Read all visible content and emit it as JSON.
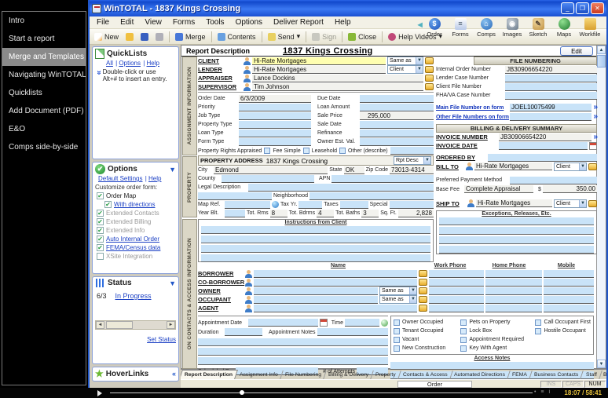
{
  "video": {
    "chapters": [
      "Intro",
      "Start a report",
      "Merge and Templates",
      "Navigating WinTOTAL",
      "Quicklists",
      "Add Document (PDF)",
      "E&O",
      "Comps side-by-side"
    ],
    "time": "18:07 / 58:41"
  },
  "window": {
    "title": "WinTOTAL - 1837 Kings Crossing",
    "menus": [
      "File",
      "Edit",
      "View",
      "Forms",
      "Tools",
      "Options",
      "Deliver Report",
      "Help"
    ],
    "toolbar": {
      "new": "New",
      "merge": "Merge",
      "contents": "Contents",
      "send": "Send",
      "sign": "Sign",
      "close": "Close",
      "help_videos": "Help Videos"
    },
    "nav_icons": [
      "Order",
      "Forms",
      "Comps",
      "Images",
      "Sketch",
      "Maps",
      "Workfile"
    ]
  },
  "sidepanel": {
    "quicklists": {
      "title": "QuickLists",
      "links": [
        "All",
        "Options",
        "Help"
      ],
      "hint": "Double-click or use Alt+# to insert an entry."
    },
    "options": {
      "title": "Options",
      "link1": "Default Settings",
      "link2": "Help",
      "caption": "Customize order form:",
      "items": [
        "Order Map",
        "With directions",
        "Extended Contacts",
        "Extended Billing",
        "Extended Info",
        "Auto Internal Order",
        "FEMA/Census data",
        "XSite Integration"
      ]
    },
    "status": {
      "title": "Status",
      "count": "6/3",
      "state": "In Progress",
      "set_link": "Set Status"
    },
    "hoverlinks": {
      "title": "HoverLinks"
    }
  },
  "form": {
    "header": {
      "section": "Report Description",
      "title": "1837 Kings Crossing",
      "edit": "Edit"
    },
    "strips": {
      "s1": "ASSIGNMENT INFORMATION",
      "s2": "PROPERTY",
      "s3": "ON CONTACTS & ACCESS INFORMATION"
    },
    "parties": {
      "client_label": "CLIENT",
      "client": "Hi-Rate Mortgages",
      "same_as": "Same as",
      "lender_label": "LENDER",
      "lender": "Hi-Rate Mortgages",
      "lender_combo": "Client",
      "appraiser_label": "APPRAISER",
      "appraiser": "Lance Dockins",
      "supervisor_label": "SUPERVISOR",
      "supervisor": "Tim Johnson"
    },
    "assignment": {
      "order_date_label": "Order Date",
      "order_date": "6/3/2009",
      "due_date_label": "Due Date",
      "priority_label": "Priority",
      "loan_amount_label": "Loan Amount",
      "job_type_label": "Job Type",
      "sale_price_label": "Sale Price",
      "sale_price": "295,000",
      "property_type_label": "Property Type",
      "sale_date_label": "Sale Date",
      "loan_type_label": "Loan Type",
      "refinance_label": "Refinance",
      "form_type_label": "Form Type",
      "owner_est_label": "Owner Est. Val.",
      "rights_label": "Property Rights Appraised",
      "fee_simple": "Fee Simple",
      "leasehold": "Leasehold",
      "other": "Other (describe)"
    },
    "property": {
      "header": "PROPERTY ADDRESS",
      "address": "1837 Kings Crossing",
      "rpt_desc": "Rpt Desc",
      "city_label": "City",
      "city": "Edmond",
      "state_label": "State",
      "state": "OK",
      "zip_label": "Zip Code",
      "zip": "73013-4314",
      "county_label": "County",
      "apn_label": "APN",
      "legal_label": "Legal Description",
      "neighborhood_label": "Neighborhood",
      "map_ref_label": "Map Ref.",
      "tax_yr_label": "Tax Yr.",
      "taxes_label": "Taxes",
      "special_label": "Special",
      "year_blt_label": "Year Blt.",
      "tot_rms_label": "Tot. Rms",
      "tot_rms": "8",
      "tot_bdrms_label": "Tot. Bdrms",
      "tot_bdrms": "4",
      "tot_baths_label": "Tot. Baths",
      "tot_baths": "3",
      "sq_ft_label": "Sq. Ft.",
      "sq_ft": "2,828"
    },
    "instructions_header": "Instructions from Client",
    "contacts": {
      "headers": [
        "Name",
        "Work Phone",
        "Home Phone",
        "Mobile"
      ],
      "rows": [
        "BORROWER",
        "CO-BORROWER",
        "OWNER",
        "OCCUPANT",
        "AGENT"
      ],
      "same_as": "Same as"
    },
    "appointment": {
      "date_label": "Appointment Date",
      "time_label": "Time",
      "duration_label": "Duration",
      "notes_label": "Appointment Notes",
      "scheduled_label": "Scheduled By",
      "attempts_label": "# of Attempts"
    },
    "occupancy": {
      "col1": [
        "Owner Occupied",
        "Tenant Occupied",
        "Vacant",
        "New Construction"
      ],
      "col2": [
        "Pets on Property",
        "Lock Box",
        "Appointment Required",
        "Key With Agent"
      ],
      "col3": [
        "Call Occupant First",
        "Hostile Occupant"
      ],
      "access_notes": "Access Notes"
    },
    "file_numbering": {
      "header": "FILE NUMBERING",
      "internal_label": "Internal Order Number",
      "internal": "JB30906654220",
      "lender_case_label": "Lender Case Number",
      "client_file_label": "Client File Number",
      "fha_label": "FHA/VA Case Number",
      "main_file_label": "Main File Number on form",
      "main_file": "JOEL10075499",
      "other_files_label": "Other File Numbers on form"
    },
    "billing": {
      "header": "BILLING & DELIVERY SUMMARY",
      "invoice_number_label": "INVOICE NUMBER",
      "invoice_number": "JB30906654220",
      "invoice_date_label": "INVOICE DATE",
      "ordered_by_label": "ORDERED BY",
      "bill_to_label": "BILL TO",
      "bill_to": "Hi-Rate Mortgages",
      "combo": "Client",
      "payment_label": "Preferred Payment Method",
      "base_fee_label": "Base Fee",
      "base_fee_desc": "Complete Appraisal",
      "currency": "$",
      "base_fee": "350.00",
      "ship_to_label": "SHIP TO",
      "ship_to": "Hi-Rate Mortgages",
      "exceptions_header": "Exceptions, Releases, Etc."
    }
  },
  "tabs": [
    "Report Description",
    "Assignment Info",
    "File Numbering",
    "Billing & Delivery",
    "Property",
    "Contacts & Access",
    "Automated Directions",
    "FEMA",
    "Business Contacts",
    "Staff",
    "Billing E"
  ],
  "statusbar": {
    "form_name": "Order",
    "ins": "INS",
    "caps": "CAPS",
    "num": "NUM"
  }
}
